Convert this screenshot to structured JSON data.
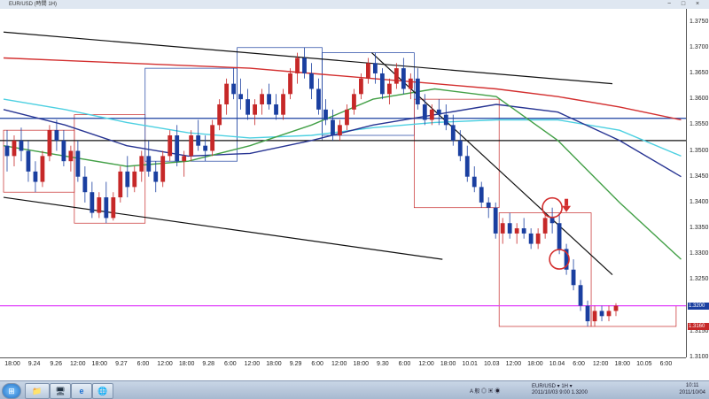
{
  "window": {
    "title": "EUR/USD (時間 1H)",
    "controls": [
      "−",
      "□",
      "×"
    ]
  },
  "price_axis": {
    "labels": [
      "1.3750",
      "1.3700",
      "1.3650",
      "1.3600",
      "1.3550",
      "1.3500",
      "1.3450",
      "1.3400",
      "1.3350",
      "1.3300",
      "1.3250",
      "1.3200",
      "1.3150",
      "1.3100"
    ],
    "current_price_tag": "1.3200",
    "low_price_tag": "1.3160",
    "current_tag_color": "#1a3fa0",
    "low_tag_color": "#c62828"
  },
  "time_axis": {
    "labels": [
      "18:00",
      "9.24",
      "9.26",
      "12:00",
      "18:00",
      "9.27",
      "6:00",
      "12:00",
      "18:00",
      "9.28",
      "6:00",
      "12:00",
      "18:00",
      "9.29",
      "6:00",
      "12:00",
      "18:00",
      "9.30",
      "6:00",
      "12:00",
      "18:00",
      "10.01",
      "10.03",
      "12:00",
      "18:00",
      "10.04",
      "6:00",
      "12:00",
      "18:00",
      "10.05",
      "6:00"
    ]
  },
  "chart_data": {
    "type": "candlestick",
    "symbol": "EUR/USD",
    "timeframe": "1H",
    "ylim": [
      1.31,
      1.3775
    ],
    "grid": false,
    "candles": [
      [
        1.351,
        1.354,
        1.346,
        1.349
      ],
      [
        1.349,
        1.353,
        1.347,
        1.352
      ],
      [
        1.352,
        1.3545,
        1.348,
        1.35
      ],
      [
        1.35,
        1.352,
        1.344,
        1.346
      ],
      [
        1.346,
        1.348,
        1.342,
        1.344
      ],
      [
        1.344,
        1.35,
        1.343,
        1.349
      ],
      [
        1.349,
        1.355,
        1.348,
        1.354
      ],
      [
        1.354,
        1.356,
        1.35,
        1.352
      ],
      [
        1.352,
        1.354,
        1.347,
        1.348
      ],
      [
        1.348,
        1.351,
        1.346,
        1.35
      ],
      [
        1.35,
        1.352,
        1.344,
        1.345
      ],
      [
        1.345,
        1.347,
        1.34,
        1.342
      ],
      [
        1.342,
        1.344,
        1.337,
        1.338
      ],
      [
        1.338,
        1.342,
        1.337,
        1.341
      ],
      [
        1.341,
        1.344,
        1.336,
        1.337
      ],
      [
        1.337,
        1.342,
        1.3365,
        1.341
      ],
      [
        1.341,
        1.347,
        1.34,
        1.346
      ],
      [
        1.346,
        1.349,
        1.341,
        1.343
      ],
      [
        1.343,
        1.347,
        1.342,
        1.346
      ],
      [
        1.346,
        1.35,
        1.344,
        1.349
      ],
      [
        1.349,
        1.352,
        1.345,
        1.346
      ],
      [
        1.346,
        1.348,
        1.342,
        1.344
      ],
      [
        1.344,
        1.35,
        1.343,
        1.349
      ],
      [
        1.349,
        1.354,
        1.348,
        1.353
      ],
      [
        1.353,
        1.355,
        1.347,
        1.348
      ],
      [
        1.348,
        1.35,
        1.345,
        1.349
      ],
      [
        1.349,
        1.354,
        1.348,
        1.353
      ],
      [
        1.353,
        1.356,
        1.35,
        1.351
      ],
      [
        1.351,
        1.353,
        1.348,
        1.35
      ],
      [
        1.35,
        1.356,
        1.349,
        1.355
      ],
      [
        1.355,
        1.36,
        1.354,
        1.359
      ],
      [
        1.359,
        1.364,
        1.357,
        1.363
      ],
      [
        1.363,
        1.366,
        1.36,
        1.361
      ],
      [
        1.361,
        1.364,
        1.358,
        1.36
      ],
      [
        1.36,
        1.362,
        1.356,
        1.357
      ],
      [
        1.357,
        1.36,
        1.355,
        1.359
      ],
      [
        1.359,
        1.362,
        1.357,
        1.361
      ],
      [
        1.361,
        1.363,
        1.358,
        1.359
      ],
      [
        1.359,
        1.361,
        1.356,
        1.357
      ],
      [
        1.357,
        1.362,
        1.356,
        1.361
      ],
      [
        1.361,
        1.366,
        1.36,
        1.365
      ],
      [
        1.365,
        1.369,
        1.363,
        1.368
      ],
      [
        1.368,
        1.37,
        1.364,
        1.365
      ],
      [
        1.365,
        1.367,
        1.36,
        1.362
      ],
      [
        1.362,
        1.364,
        1.357,
        1.358
      ],
      [
        1.358,
        1.36,
        1.355,
        1.356
      ],
      [
        1.356,
        1.358,
        1.352,
        1.353
      ],
      [
        1.353,
        1.356,
        1.352,
        1.355
      ],
      [
        1.355,
        1.359,
        1.354,
        1.358
      ],
      [
        1.358,
        1.362,
        1.357,
        1.361
      ],
      [
        1.361,
        1.365,
        1.36,
        1.364
      ],
      [
        1.364,
        1.368,
        1.363,
        1.367
      ],
      [
        1.367,
        1.369,
        1.363,
        1.365
      ],
      [
        1.365,
        1.366,
        1.36,
        1.361
      ],
      [
        1.361,
        1.364,
        1.359,
        1.363
      ],
      [
        1.363,
        1.367,
        1.362,
        1.366
      ],
      [
        1.366,
        1.368,
        1.361,
        1.362
      ],
      [
        1.362,
        1.365,
        1.36,
        1.364
      ],
      [
        1.364,
        1.366,
        1.358,
        1.359
      ],
      [
        1.359,
        1.361,
        1.355,
        1.356
      ],
      [
        1.356,
        1.359,
        1.355,
        1.358
      ],
      [
        1.358,
        1.36,
        1.355,
        1.357
      ],
      [
        1.357,
        1.359,
        1.354,
        1.355
      ],
      [
        1.355,
        1.357,
        1.351,
        1.352
      ],
      [
        1.352,
        1.354,
        1.348,
        1.349
      ],
      [
        1.349,
        1.351,
        1.344,
        1.345
      ],
      [
        1.345,
        1.347,
        1.342,
        1.343
      ],
      [
        1.343,
        1.344,
        1.339,
        1.34
      ],
      [
        1.34,
        1.341,
        1.337,
        1.339
      ],
      [
        1.339,
        1.34,
        1.333,
        1.334
      ],
      [
        1.334,
        1.337,
        1.332,
        1.336
      ],
      [
        1.336,
        1.338,
        1.333,
        1.334
      ],
      [
        1.334,
        1.336,
        1.332,
        1.335
      ],
      [
        1.335,
        1.337,
        1.333,
        1.334
      ],
      [
        1.334,
        1.335,
        1.331,
        1.332
      ],
      [
        1.332,
        1.335,
        1.331,
        1.334
      ],
      [
        1.334,
        1.338,
        1.333,
        1.337
      ],
      [
        1.337,
        1.339,
        1.334,
        1.336
      ],
      [
        1.336,
        1.338,
        1.33,
        1.331
      ],
      [
        1.331,
        1.332,
        1.326,
        1.327
      ],
      [
        1.327,
        1.329,
        1.323,
        1.324
      ],
      [
        1.324,
        1.325,
        1.319,
        1.32
      ],
      [
        1.32,
        1.321,
        1.316,
        1.317
      ],
      [
        1.317,
        1.32,
        1.316,
        1.319
      ],
      [
        1.319,
        1.32,
        1.317,
        1.318
      ],
      [
        1.318,
        1.32,
        1.317,
        1.319
      ],
      [
        1.319,
        1.3205,
        1.318,
        1.32
      ]
    ],
    "bull_color": "#c62828",
    "bear_color": "#1a3fa0",
    "moving_averages": [
      {
        "color": "#d32f2f",
        "values": [
          1.368,
          1.3675,
          1.367,
          1.3665,
          1.366,
          1.365,
          1.364,
          1.363,
          1.362,
          1.3605,
          1.3585,
          1.356
        ]
      },
      {
        "color": "#4dd0e1",
        "values": [
          1.36,
          1.358,
          1.3555,
          1.3535,
          1.3525,
          1.353,
          1.3545,
          1.3555,
          1.356,
          1.356,
          1.354,
          1.349
        ]
      },
      {
        "color": "#283593",
        "values": [
          1.358,
          1.355,
          1.351,
          1.349,
          1.3495,
          1.352,
          1.355,
          1.357,
          1.359,
          1.3575,
          1.352,
          1.345
        ]
      },
      {
        "color": "#43a047",
        "values": [
          1.351,
          1.349,
          1.347,
          1.348,
          1.351,
          1.355,
          1.36,
          1.362,
          1.3605,
          1.352,
          1.34,
          1.329
        ]
      }
    ],
    "horizontal_lines": [
      {
        "price": 1.3563,
        "color": "#1a3fa0"
      },
      {
        "price": 1.352,
        "color": "#111111"
      },
      {
        "price": 1.32,
        "color": "#e040fb"
      }
    ],
    "trend_lines": [
      {
        "color": "#111111",
        "from": [
          0,
          1.373
        ],
        "to": [
          86,
          1.363
        ]
      },
      {
        "color": "#111111",
        "from": [
          0,
          1.341
        ],
        "to": [
          62,
          1.329
        ]
      },
      {
        "color": "#111111",
        "from": [
          52,
          1.369
        ],
        "to": [
          86,
          1.326
        ]
      }
    ],
    "session_boxes": [
      {
        "from": 0,
        "to": 10,
        "high": 1.354,
        "low": 1.342,
        "color": "#c62828"
      },
      {
        "from": 10,
        "to": 20,
        "high": 1.357,
        "low": 1.336,
        "color": "#c62828"
      },
      {
        "from": 20,
        "to": 33,
        "high": 1.366,
        "low": 1.348,
        "color": "#1a3fa0"
      },
      {
        "from": 33,
        "to": 45,
        "high": 1.37,
        "low": 1.352,
        "color": "#1a3fa0"
      },
      {
        "from": 45,
        "to": 58,
        "high": 1.369,
        "low": 1.353,
        "color": "#1a3fa0"
      },
      {
        "from": 58,
        "to": 70,
        "high": 1.36,
        "low": 1.339,
        "color": "#c62828"
      },
      {
        "from": 70,
        "to": 83,
        "high": 1.338,
        "low": 1.316,
        "color": "#c62828"
      },
      {
        "from": 83,
        "to": 95,
        "high": 1.32,
        "low": 1.316,
        "color": "#c62828"
      }
    ],
    "annotations": [
      {
        "type": "circle",
        "candle": 77,
        "price": 1.339,
        "color": "#d32f2f"
      },
      {
        "type": "circle",
        "candle": 78,
        "price": 1.329,
        "color": "#d32f2f"
      },
      {
        "type": "arrow-down",
        "candle": 79,
        "price": 1.339,
        "color": "#d32f2f"
      }
    ]
  },
  "taskbar": {
    "start_label": "⊞",
    "apps": [
      "📁",
      "🖥",
      "e",
      "🌐"
    ],
    "tray_text_1": "A 般 ◎ ▣ ◉",
    "tray_text_2": "EUR/USD ▾  1H ▾",
    "tray_text_3": "2011/10/03 9:00   1.3200",
    "clock_time": "10:11",
    "clock_date": "2011/10/04"
  }
}
